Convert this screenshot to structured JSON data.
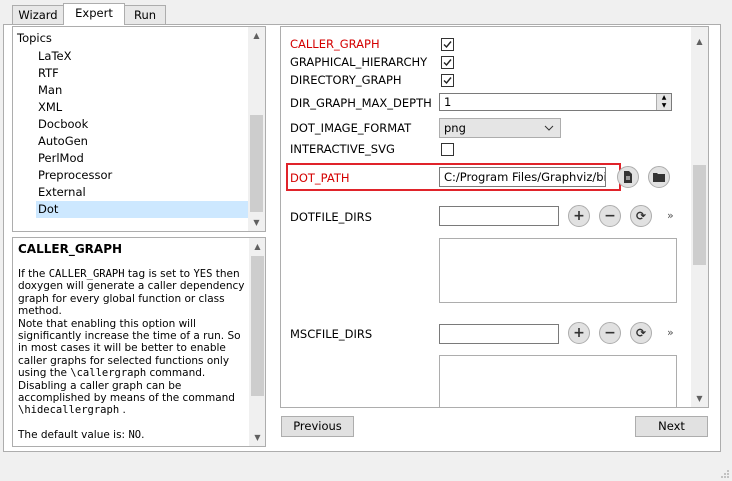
{
  "tabs": [
    {
      "label": "Wizard"
    },
    {
      "label": "Expert"
    },
    {
      "label": "Run"
    }
  ],
  "topics": {
    "header": "Topics",
    "items": [
      "LaTeX",
      "RTF",
      "Man",
      "XML",
      "Docbook",
      "AutoGen",
      "PerlMod",
      "Preprocessor",
      "External",
      "Dot"
    ],
    "selected": "Dot"
  },
  "help": {
    "title": "CALLER_GRAPH",
    "p1_a": "If the ",
    "p1_tag": "CALLER_GRAPH",
    "p1_b": " tag is set to ",
    "p1_yes": "YES",
    "p1_c": " then doxygen will generate a caller dependency graph for every global function or class method.",
    "p2_a": "Note that enabling this option will significantly increase the time of a run. So in most cases it will be better to enable caller graphs for selected functions only using the ",
    "p2_cmd": "\\callergraph",
    "p2_b": " command. Disabling a caller graph can be accomplished by means of the command ",
    "p2_cmd2": "\\hidecallergraph",
    "p2_c": " .",
    "p3_a": "The default value is: ",
    "p3_val": "NO",
    "p3_b": "."
  },
  "settings": {
    "caller_graph": {
      "label": "CALLER_GRAPH",
      "checked": true
    },
    "graphical_hierarchy": {
      "label": "GRAPHICAL_HIERARCHY",
      "checked": true
    },
    "directory_graph": {
      "label": "DIRECTORY_GRAPH",
      "checked": true
    },
    "dir_graph_max_depth": {
      "label": "DIR_GRAPH_MAX_DEPTH",
      "value": "1"
    },
    "dot_image_format": {
      "label": "DOT_IMAGE_FORMAT",
      "value": "png"
    },
    "interactive_svg": {
      "label": "INTERACTIVE_SVG",
      "checked": false
    },
    "dot_path": {
      "label": "DOT_PATH",
      "value": "C:/Program Files/Graphviz/bin"
    },
    "dotfile_dirs": {
      "label": "DOTFILE_DIRS",
      "value": ""
    },
    "mscfile_dirs": {
      "label": "MSCFILE_DIRS",
      "value": ""
    },
    "more_glyph": "»"
  },
  "buttons": {
    "previous": "Previous",
    "next": "Next"
  },
  "colors": {
    "highlight_border": "#e0232a",
    "modified_label": "#d40000",
    "selection": "#cde8ff"
  }
}
